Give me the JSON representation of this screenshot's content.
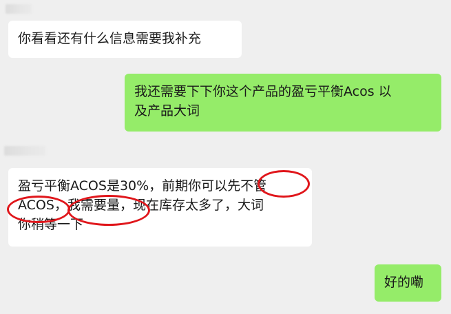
{
  "chat": {
    "messages": [
      {
        "side": "left",
        "lines": [
          "你看看还有什么信息需要我补充"
        ]
      },
      {
        "side": "right",
        "lines": [
          "我还需要下下你这个产品的盈亏平衡Acos 以",
          "及产品大词"
        ]
      },
      {
        "side": "left",
        "lines": [
          "盈亏平衡ACOS是30%，前期你可以先不管",
          "ACOS，我需要量，现在库存太多了，大词",
          "你稍等一下"
        ]
      },
      {
        "side": "right",
        "lines": [
          "好的嘞"
        ]
      }
    ]
  },
  "annotations": {
    "color": "#e0161b",
    "highlights": [
      "先不管",
      "ACOS",
      "我需要量"
    ]
  }
}
